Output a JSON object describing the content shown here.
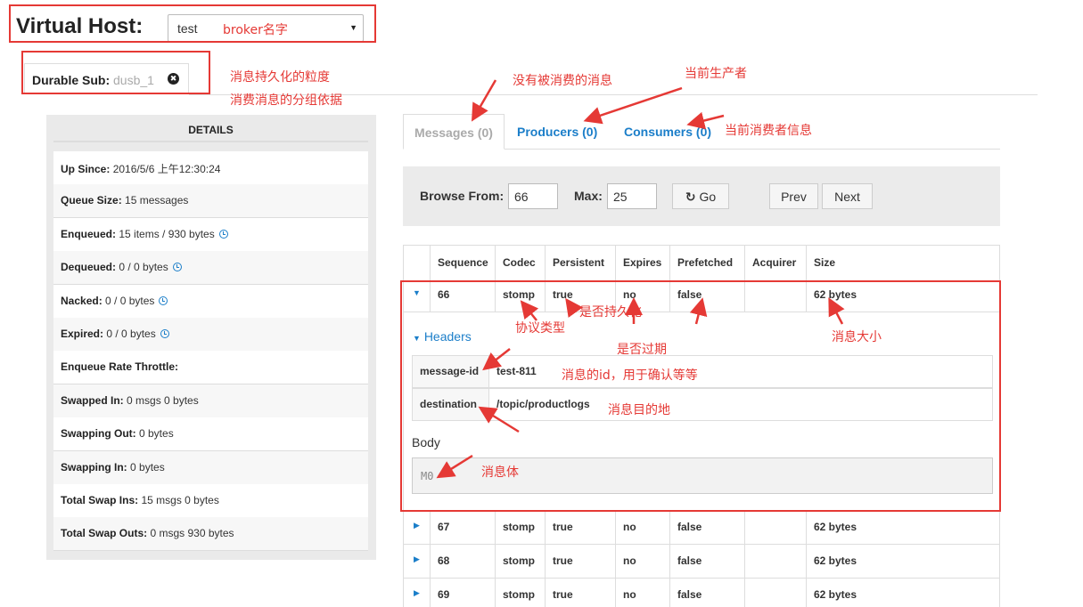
{
  "header": {
    "vhost_label": "Virtual Host:",
    "vhost_value": "test",
    "vhost_caret": "▼"
  },
  "durable_sub": {
    "label": "Durable Sub:",
    "value": "dusb_1",
    "close": "✖"
  },
  "details": {
    "title": "DETAILS",
    "rows": [
      {
        "label": "Up Since:",
        "value": "2016/5/6 上午12:30:24",
        "clock": false
      },
      {
        "label": "Queue Size:",
        "value": "15 messages",
        "clock": false
      },
      {
        "label": "Enqueued:",
        "value": "15 items / 930 bytes",
        "clock": true
      },
      {
        "label": "Dequeued:",
        "value": "0 / 0 bytes",
        "clock": true
      },
      {
        "label": "Nacked:",
        "value": "0 / 0 bytes",
        "clock": true
      },
      {
        "label": "Expired:",
        "value": "0 / 0 bytes",
        "clock": true
      },
      {
        "label": "Enqueue Rate Throttle:",
        "value": "",
        "clock": false
      },
      {
        "label": "Swapped In:",
        "value": "0 msgs 0 bytes",
        "clock": false
      },
      {
        "label": "Swapping Out:",
        "value": "0 bytes",
        "clock": false
      },
      {
        "label": "Swapping In:",
        "value": "0 bytes",
        "clock": false
      },
      {
        "label": "Total Swap Ins:",
        "value": "15 msgs 0 bytes",
        "clock": false
      },
      {
        "label": "Total Swap Outs:",
        "value": "0 msgs 930 bytes",
        "clock": false
      }
    ]
  },
  "tabs": {
    "messages": "Messages (0)",
    "producers": "Producers (0)",
    "consumers": "Consumers (0)"
  },
  "browse": {
    "from_label": "Browse From:",
    "from_value": "66",
    "max_label": "Max:",
    "max_value": "25",
    "go_label": "Go",
    "go_icon": "↻",
    "prev_label": "Prev",
    "next_label": "Next"
  },
  "table": {
    "columns": [
      "Sequence",
      "Codec",
      "Persistent",
      "Expires",
      "Prefetched",
      "Acquirer",
      "Size"
    ],
    "expanded_row": {
      "seq": "66",
      "codec": "stomp",
      "persistent": "true",
      "expires": "no",
      "prefetched": "false",
      "acquirer": "",
      "size": "62 bytes"
    },
    "headers_toggle": "Headers",
    "headers": [
      {
        "key": "message-id",
        "value": "test-811"
      },
      {
        "key": "destination",
        "value": "/topic/productlogs"
      }
    ],
    "body_label": "Body",
    "body_value": "M0",
    "rows": [
      {
        "seq": "67",
        "codec": "stomp",
        "persistent": "true",
        "expires": "no",
        "prefetched": "false",
        "acquirer": "",
        "size": "62 bytes"
      },
      {
        "seq": "68",
        "codec": "stomp",
        "persistent": "true",
        "expires": "no",
        "prefetched": "false",
        "acquirer": "",
        "size": "62 bytes"
      },
      {
        "seq": "69",
        "codec": "stomp",
        "persistent": "true",
        "expires": "no",
        "prefetched": "false",
        "acquirer": "",
        "size": "62 bytes"
      }
    ]
  },
  "annotations": {
    "broker_name": "broker名字",
    "durable_granularity": "消息持久化的粒度",
    "grouping_basis": "消费消息的分组依据",
    "unconsumed": "没有被消费的消息",
    "current_producer": "当前生产者",
    "current_consumer": "当前消费者信息",
    "protocol_type": "协议类型",
    "is_persistent": "是否持久化",
    "is_expired": "是否过期",
    "message_size": "消息大小",
    "message_id": "消息的id，用于确认等等",
    "destination": "消息目的地",
    "body": "消息体"
  },
  "colors": {
    "accent": "#1b7ec9",
    "annotation": "#e53935"
  }
}
